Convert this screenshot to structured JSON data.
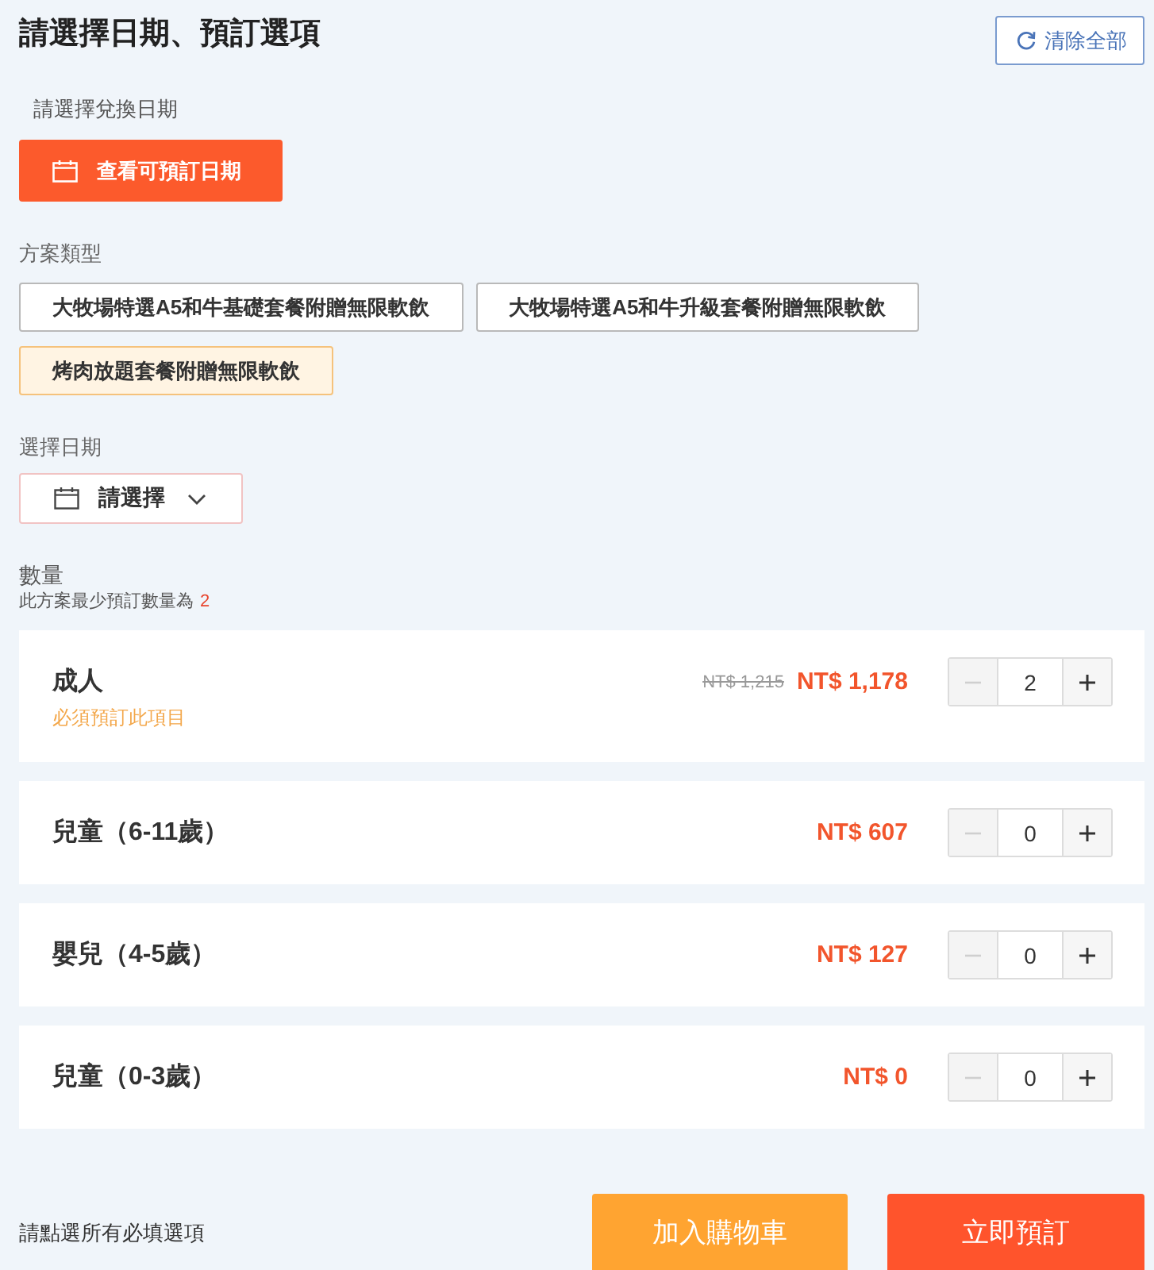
{
  "header": {
    "title": "請選擇日期、預訂選項",
    "clear_button": "清除全部"
  },
  "redeem_date": {
    "label": "請選擇兌換日期",
    "button": "查看可預訂日期"
  },
  "plan_type": {
    "label": "方案類型",
    "options": [
      {
        "label": "大牧場特選A5和牛基礎套餐附贈無限軟飲",
        "selected": false
      },
      {
        "label": "大牧場特選A5和牛升級套餐附贈無限軟飲",
        "selected": false
      },
      {
        "label": "烤肉放題套餐附贈無限軟飲",
        "selected": true
      }
    ]
  },
  "date": {
    "label": "選擇日期",
    "prompt": "請選擇"
  },
  "quantity": {
    "label": "數量",
    "note": "此方案最少預訂數量為",
    "minimum": "2",
    "items": [
      {
        "name": "成人",
        "required_note": "必須預訂此項目",
        "original_price": "NT$ 1,215",
        "price": "NT$ 1,178",
        "count": "2",
        "minus_disabled": true,
        "plus_disabled": false
      },
      {
        "name": "兒童（6-11歲）",
        "price": "NT$ 607",
        "count": "0",
        "minus_disabled": true,
        "plus_disabled": false
      },
      {
        "name": "嬰兒（4-5歲）",
        "price": "NT$ 127",
        "count": "0",
        "minus_disabled": true,
        "plus_disabled": false
      },
      {
        "name": "兒童（0-3歲）",
        "price": "NT$ 0",
        "count": "0",
        "minus_disabled": true,
        "plus_disabled": false
      }
    ]
  },
  "footer": {
    "hint": "請點選所有必填選項",
    "buttons": [
      {
        "label": "加入購物車",
        "kind": "cart"
      },
      {
        "label": "立即預訂",
        "kind": "book"
      }
    ]
  }
}
